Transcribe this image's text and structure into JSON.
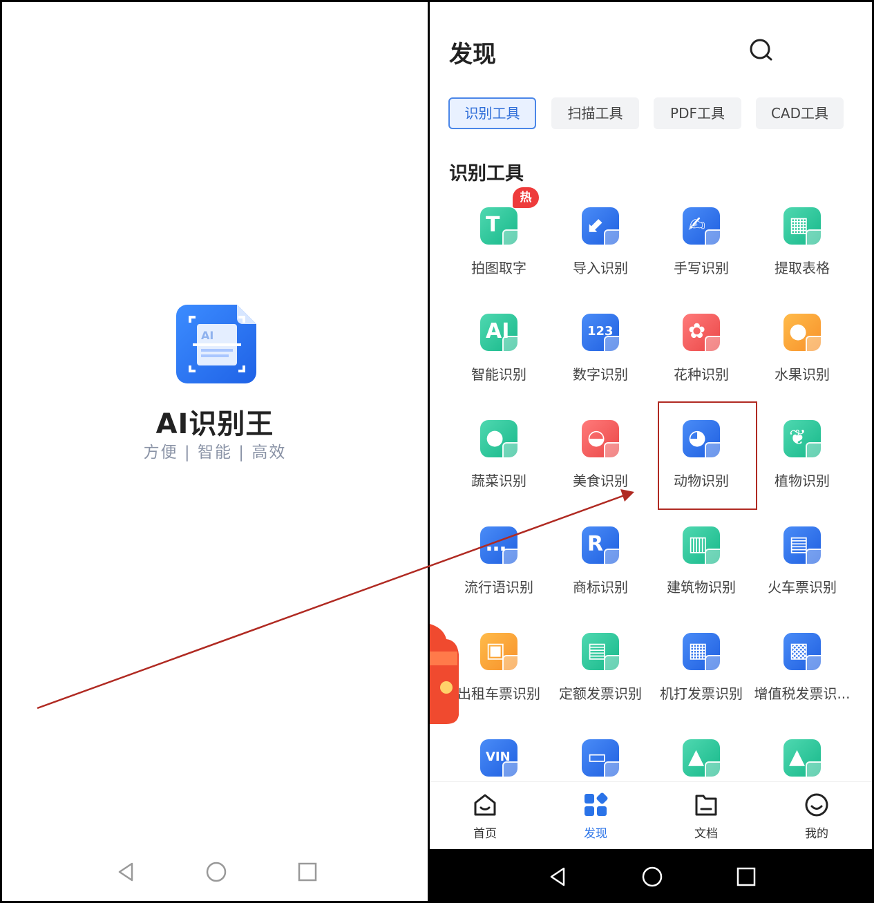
{
  "splash": {
    "app_name": "AI识别王",
    "slogan": "方便 | 智能 | 高效",
    "logo_text": "AI"
  },
  "discover": {
    "title": "发现",
    "chips": [
      "识别工具",
      "扫描工具",
      "PDF工具",
      "CAD工具"
    ],
    "active_chip": "识别工具",
    "section_title": "识别工具",
    "hot_badge": "热",
    "tools": [
      {
        "label": "拍图取字",
        "color": "green",
        "glyph": "T"
      },
      {
        "label": "导入识别",
        "color": "blue",
        "glyph": "⬋"
      },
      {
        "label": "手写识别",
        "color": "blue",
        "glyph": "✍"
      },
      {
        "label": "提取表格",
        "color": "green",
        "glyph": "▦"
      },
      {
        "label": "智能识别",
        "color": "green",
        "glyph": "AI"
      },
      {
        "label": "数字识别",
        "color": "blue",
        "glyph": "123"
      },
      {
        "label": "花种识别",
        "color": "red",
        "glyph": "✿"
      },
      {
        "label": "水果识别",
        "color": "orange",
        "glyph": "●"
      },
      {
        "label": "蔬菜识别",
        "color": "green",
        "glyph": "●"
      },
      {
        "label": "美食识别",
        "color": "red",
        "glyph": "◒"
      },
      {
        "label": "动物识别",
        "color": "blue",
        "glyph": "◕"
      },
      {
        "label": "植物识别",
        "color": "green",
        "glyph": "❦"
      },
      {
        "label": "流行语识别",
        "color": "blue",
        "glyph": "…"
      },
      {
        "label": "商标识别",
        "color": "blue",
        "glyph": "R"
      },
      {
        "label": "建筑物识别",
        "color": "green",
        "glyph": "▥"
      },
      {
        "label": "火车票识别",
        "color": "blue",
        "glyph": "▤"
      },
      {
        "label": "出租车票识别",
        "color": "orange",
        "glyph": "▣"
      },
      {
        "label": "定额发票识别",
        "color": "green",
        "glyph": "▤"
      },
      {
        "label": "机打发票识别",
        "color": "blue",
        "glyph": "▦"
      },
      {
        "label": "增值税发票识...",
        "color": "blue",
        "glyph": "▩"
      },
      {
        "label": "",
        "color": "blue",
        "glyph": "VIN"
      },
      {
        "label": "",
        "color": "blue",
        "glyph": "▭"
      },
      {
        "label": "",
        "color": "green",
        "glyph": "▲"
      },
      {
        "label": "",
        "color": "green",
        "glyph": "▲"
      }
    ],
    "highlighted_tool": "动物识别",
    "tabbar": [
      {
        "label": "首页",
        "icon": "home-icon"
      },
      {
        "label": "发现",
        "icon": "discover-icon"
      },
      {
        "label": "文档",
        "icon": "document-icon"
      },
      {
        "label": "我的",
        "icon": "profile-icon"
      }
    ],
    "active_tab": "发现"
  },
  "colors": {
    "accent": "#2a73e8",
    "annotation": "#b02a22",
    "hot": "#ee3b3b"
  }
}
